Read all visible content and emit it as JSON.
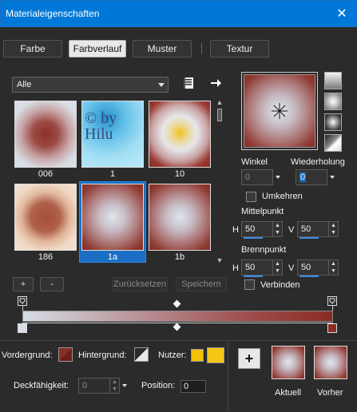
{
  "window": {
    "title": "Materialeigenschaften",
    "close_glyph": "✕"
  },
  "tabs": [
    {
      "label": "Farbe"
    },
    {
      "label": "Farbverlauf"
    },
    {
      "label": "Muster"
    },
    {
      "label": "Textur"
    }
  ],
  "category": {
    "selected": "Alle"
  },
  "gradients": [
    {
      "label": "006"
    },
    {
      "label": "1",
      "watermark": "© by Hilu"
    },
    {
      "label": "10"
    },
    {
      "label": "186"
    },
    {
      "label": "1a"
    },
    {
      "label": "1b"
    }
  ],
  "list_buttons": {
    "add": "+",
    "remove": "-",
    "reset": "Zurücksetzen",
    "save": "Speichern"
  },
  "style_panel": {
    "angle_label": "Winkel",
    "angle_value": "0",
    "repeat_label": "Wiederholung",
    "repeat_value": "0",
    "reverse_label": "Umkehren",
    "center_label": "Mittelpunkt",
    "center_h_label": "H",
    "center_h": "50",
    "center_v_label": "V",
    "center_v": "50",
    "focal_label": "Brennpunkt",
    "focal_h_label": "H",
    "focal_h": "50",
    "focal_v_label": "V",
    "focal_v": "50",
    "link_label": "Verbinden"
  },
  "footer": {
    "foreground_label": "Vordergrund:",
    "background_label": "Hintergrund:",
    "user_label": "Nutzer:",
    "opacity_label": "Deckfähigkeit:",
    "opacity_value": "0",
    "position_label": "Position:",
    "position_value": "0",
    "current_label": "Aktuell",
    "previous_label": "Vorher",
    "add_glyph": "+"
  },
  "colors": {
    "accent": "#0078d7",
    "foreground_color": "#8a2c23",
    "user_color_1": "#f2c200",
    "user_color_2": "#f5c518",
    "gradient_start": "#d6dde6",
    "gradient_end": "#8a2c23"
  },
  "icons": {
    "library_icon": "book-icon",
    "next_icon": "arrow-right-icon"
  }
}
